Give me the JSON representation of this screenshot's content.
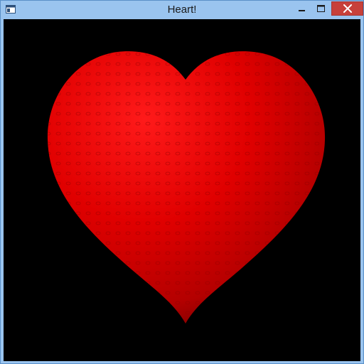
{
  "window": {
    "title": "Heart!",
    "icons": {
      "app": "window-app-icon",
      "minimize": "minimize-icon",
      "maximize": "maximize-icon",
      "close": "close-icon"
    }
  },
  "canvas": {
    "background_color": "#000000",
    "heart_color": "#e00000",
    "heart_highlight_color": "#ff2a2a",
    "heart_shadow_color": "#7a0000"
  },
  "colors": {
    "titlebar": "#9ac4ef",
    "close_button": "#c7403a"
  }
}
